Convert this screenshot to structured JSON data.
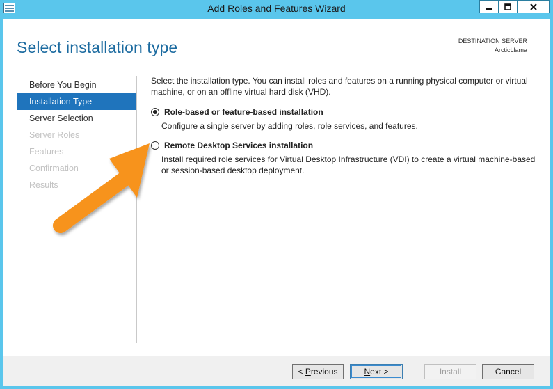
{
  "window": {
    "title": "Add Roles and Features Wizard",
    "controls": {
      "minimize": "minimize",
      "maximize": "maximize",
      "close": "close"
    }
  },
  "header": {
    "page_title": "Select installation type",
    "destination_label": "DESTINATION SERVER",
    "destination_name": "ArcticLlama"
  },
  "nav": {
    "items": [
      {
        "label": "Before You Begin",
        "state": "normal"
      },
      {
        "label": "Installation Type",
        "state": "active"
      },
      {
        "label": "Server Selection",
        "state": "normal"
      },
      {
        "label": "Server Roles",
        "state": "disabled"
      },
      {
        "label": "Features",
        "state": "disabled"
      },
      {
        "label": "Confirmation",
        "state": "disabled"
      },
      {
        "label": "Results",
        "state": "disabled"
      }
    ]
  },
  "content": {
    "intro": "Select the installation type. You can install roles and features on a running physical computer or virtual machine, or on an offline virtual hard disk (VHD).",
    "options": [
      {
        "title": "Role-based or feature-based installation",
        "description": "Configure a single server by adding roles, role services, and features.",
        "selected": true
      },
      {
        "title": "Remote Desktop Services installation",
        "description": "Install required role services for Virtual Desktop Infrastructure (VDI) to create a virtual machine-based or session-based desktop deployment.",
        "selected": false
      }
    ]
  },
  "footer": {
    "previous": {
      "prefix": "< ",
      "mnemonic": "P",
      "rest": "revious"
    },
    "next": {
      "mnemonic": "N",
      "rest": "ext >"
    },
    "install": "Install",
    "cancel": "Cancel"
  },
  "colors": {
    "frame": "#5ac6ec",
    "accent": "#1f74bc",
    "title_text": "#1c6ba0",
    "arrow": "#f7931e"
  },
  "icons": {
    "app": "server-manager-icon",
    "annotation": "orange-arrow-icon"
  }
}
